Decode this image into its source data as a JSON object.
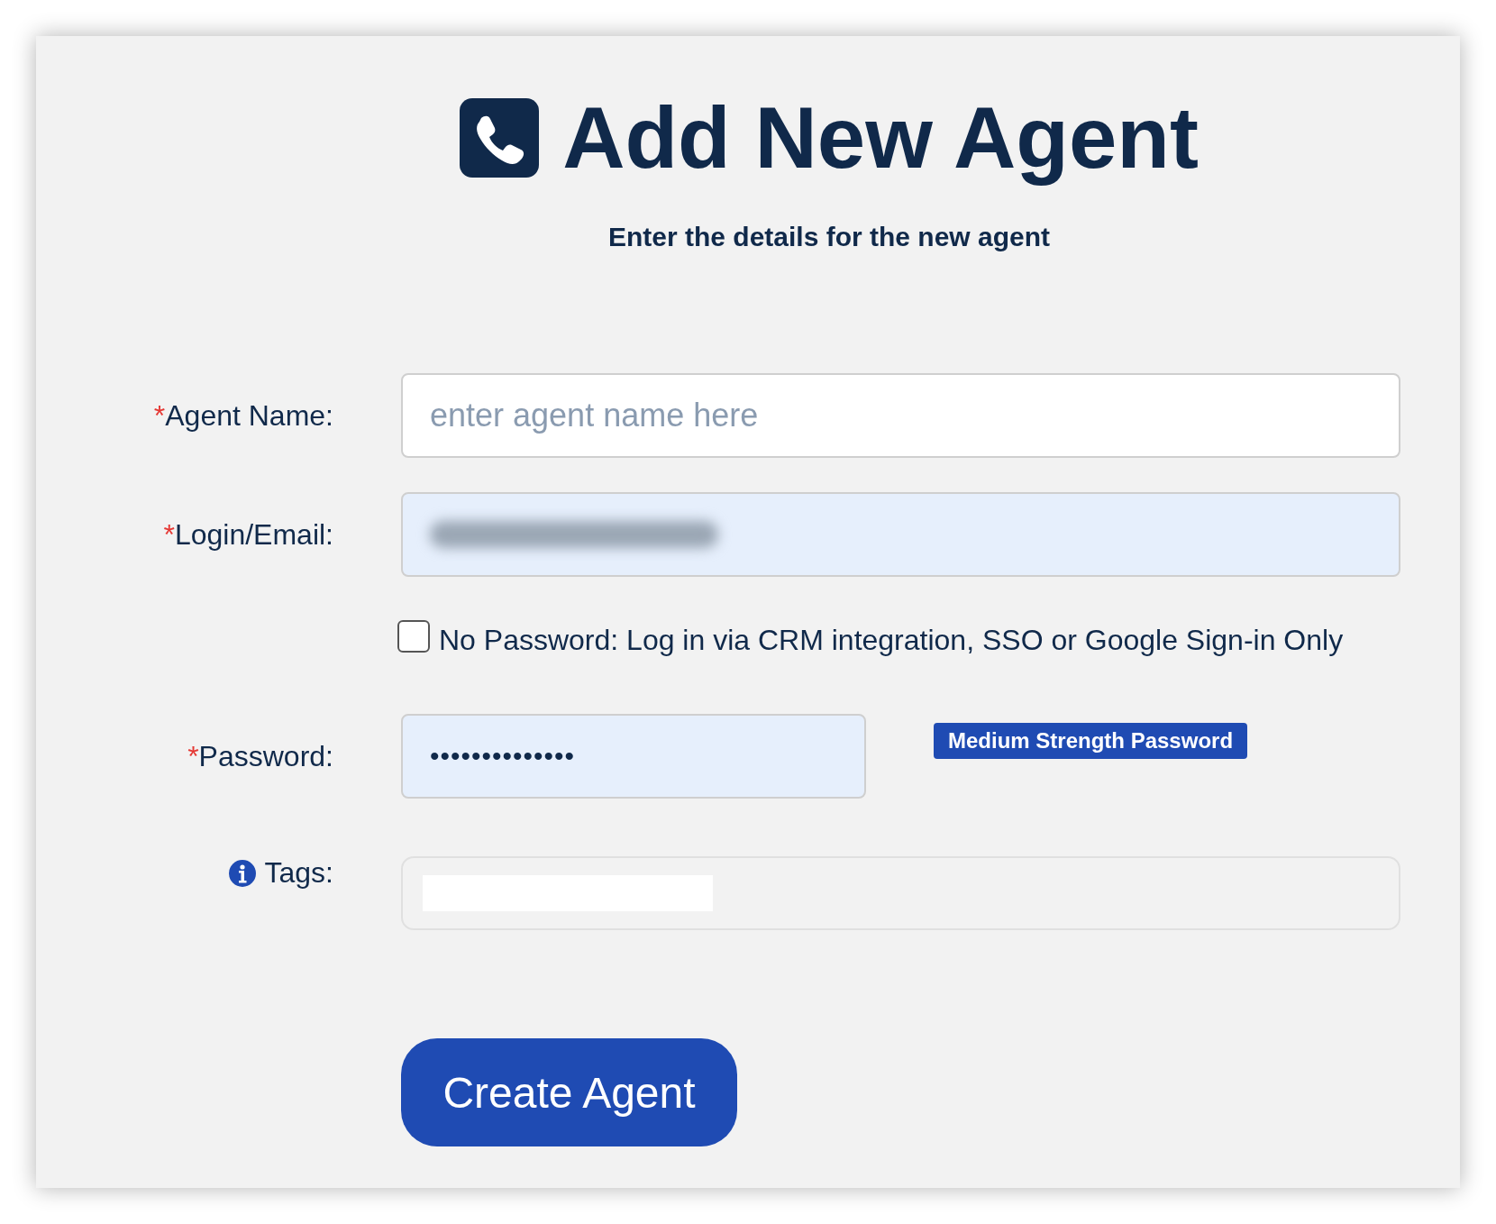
{
  "title": "Add New Agent",
  "subtitle": "Enter the details for the new agent",
  "fields": [
    {
      "kind": "text",
      "required_mark": "*",
      "label": "Agent Name:",
      "placeholder": "enter agent name here"
    },
    {
      "kind": "blurred",
      "required_mark": "*",
      "label": "Login/Email:"
    },
    {
      "kind": "checkbox",
      "label": "No Password: Log in via CRM integration, SSO or Google Sign-in Only",
      "checked": false
    },
    {
      "kind": "password",
      "required_mark": "*",
      "label": "Password:",
      "value": "••••••••••••••",
      "badge": "Medium Strength Password"
    },
    {
      "kind": "tags",
      "label": "Tags:"
    }
  ],
  "submit": "Create Agent"
}
